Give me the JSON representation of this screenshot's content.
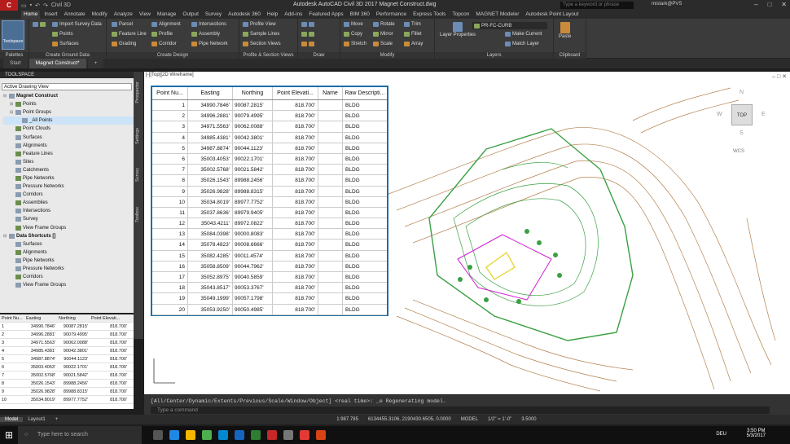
{
  "app": {
    "title": "Autodesk AutoCAD Civil 3D 2017    Magnet Construct.dwg",
    "workspace": "Civil 3D",
    "search_placeholder": "Type a keyword or phrase",
    "user": "mistark@PVS"
  },
  "ribbon_tabs": [
    "Home",
    "Insert",
    "Annotate",
    "Modify",
    "Analyze",
    "View",
    "Manage",
    "Output",
    "Survey",
    "Autodesk 360",
    "Help",
    "Add-ins",
    "Featured Apps",
    "BIM 360",
    "Performance",
    "Express Tools",
    "Topcon",
    "MAGNET Modeler",
    "Autodesk Point Layout"
  ],
  "ribbon": {
    "toolspace": "Toolspace",
    "palettes": "Palettes",
    "create_ground": {
      "label": "Create Ground Data",
      "items": [
        "Import Survey Data",
        "Points",
        "Surfaces"
      ]
    },
    "create_design": {
      "label": "Create Design",
      "items": [
        "Parcel",
        "Feature Line",
        "Grading",
        "Alignment",
        "Profile",
        "Corridor",
        "Intersections",
        "Assembly",
        "Pipe Network"
      ]
    },
    "profile_section": {
      "label": "Profile & Section Views",
      "items": [
        "Profile View",
        "Sample Lines",
        "Section Views"
      ]
    },
    "draw": {
      "label": "Draw"
    },
    "modify": {
      "label": "Modify",
      "items": [
        "Move",
        "Rotate",
        "Trim",
        "Copy",
        "Mirror",
        "Fillet",
        "Stretch",
        "Scale",
        "Array"
      ]
    },
    "layers": {
      "label": "Layers",
      "layer_name": "PR-FC-CURB",
      "items": [
        "Layer Properties",
        "Make Current",
        "Match Layer"
      ]
    },
    "clipboard": {
      "label": "Clipboard",
      "paste": "Paste"
    }
  },
  "file_tabs": [
    "Start",
    "Magnet Construct*"
  ],
  "toolspace": {
    "title": "TOOLSPACE",
    "view": "Active Drawing View",
    "tree": [
      "Magnet Construct",
      "Points",
      "Point Groups",
      "_All Points",
      "Point Clouds",
      "Surfaces",
      "Alignments",
      "Feature Lines",
      "Sites",
      "Catchments",
      "Pipe Networks",
      "Pressure Networks",
      "Corridors",
      "Assemblies",
      "Intersections",
      "Survey",
      "View Frame Groups",
      "Data Shortcuts []",
      "Surfaces",
      "Alignments",
      "Pipe Networks",
      "Pressure Networks",
      "Corridors",
      "View Frame Groups"
    ],
    "side_tabs": [
      "Prospector",
      "Settings",
      "Survey",
      "Toolbox"
    ]
  },
  "viewport": {
    "label": "[-][Top][2D Wireframe]",
    "cube": "TOP",
    "wcs": "WCS",
    "north": "N",
    "south": "S",
    "east": "E",
    "west": "W"
  },
  "point_table": {
    "headers": [
      "Point Nu...",
      "Easting",
      "Northing",
      "Point Elevati...",
      "Name",
      "Raw Descripti..."
    ],
    "rows": [
      [
        "1",
        "34990.7846'",
        "90087.2815'",
        "818.700'",
        "",
        "BLDG"
      ],
      [
        "2",
        "34996.2881'",
        "90079.4995'",
        "818.700'",
        "",
        "BLDG"
      ],
      [
        "3",
        "34971.5563'",
        "90062.0088'",
        "818.700'",
        "",
        "BLDG"
      ],
      [
        "4",
        "34985.4381'",
        "90042.3801'",
        "818.700'",
        "",
        "BLDG"
      ],
      [
        "5",
        "34987.8874'",
        "90044.1123'",
        "818.700'",
        "",
        "BLDG"
      ],
      [
        "6",
        "35003.4053'",
        "90022.1701'",
        "818.700'",
        "",
        "BLDG"
      ],
      [
        "7",
        "35002.5768'",
        "90021.5842'",
        "818.700'",
        "",
        "BLDG"
      ],
      [
        "8",
        "35026.1543'",
        "89988.2456'",
        "818.700'",
        "",
        "BLDG"
      ],
      [
        "9",
        "35026.9828'",
        "89988.8315'",
        "818.700'",
        "",
        "BLDG"
      ],
      [
        "10",
        "35034.8019'",
        "89977.7752'",
        "818.700'",
        "",
        "BLDG"
      ],
      [
        "11",
        "35037.8636'",
        "89979.9405'",
        "818.700'",
        "",
        "BLDG"
      ],
      [
        "12",
        "35043.4211'",
        "89972.0822'",
        "818.700'",
        "",
        "BLDG"
      ],
      [
        "13",
        "35084.0398'",
        "90000.8083'",
        "818.700'",
        "",
        "BLDG"
      ],
      [
        "14",
        "35078.4823'",
        "90008.6666'",
        "818.700'",
        "",
        "BLDG"
      ],
      [
        "15",
        "35082.4285'",
        "90011.4574'",
        "818.700'",
        "",
        "BLDG"
      ],
      [
        "16",
        "35058.8509'",
        "90044.7962'",
        "818.700'",
        "",
        "BLDG"
      ],
      [
        "17",
        "35052.8975'",
        "90040.5859'",
        "818.700'",
        "",
        "BLDG"
      ],
      [
        "18",
        "35043.8517'",
        "90053.3767'",
        "818.700'",
        "",
        "BLDG"
      ],
      [
        "19",
        "35049.1999'",
        "90057.1798'",
        "818.700'",
        "",
        "BLDG"
      ],
      [
        "20",
        "35053.9250'",
        "90050.4985'",
        "818.700'",
        "",
        "BLDG"
      ]
    ]
  },
  "bottom_grid": {
    "headers": [
      "Point Nu...",
      "Easting",
      "Northing",
      "Point Elevati..."
    ],
    "rows": [
      [
        "1",
        "34990.7846'",
        "90087.2815'",
        "818.700'"
      ],
      [
        "2",
        "34996.2881'",
        "90079.4995'",
        "818.700'"
      ],
      [
        "3",
        "34971.5563'",
        "90062.0088'",
        "818.700'"
      ],
      [
        "4",
        "34985.4381'",
        "90042.3801'",
        "818.700'"
      ],
      [
        "5",
        "34987.8874'",
        "90044.1123'",
        "818.700'"
      ],
      [
        "6",
        "35003.4053'",
        "90022.1701'",
        "818.700'"
      ],
      [
        "7",
        "35002.5768'",
        "90021.5842'",
        "818.700'"
      ],
      [
        "8",
        "35026.1543'",
        "89988.2456'",
        "818.700'"
      ],
      [
        "9",
        "35026.9828'",
        "89988.8315'",
        "818.700'"
      ],
      [
        "10",
        "35034.8019'",
        "89977.7752'",
        "818.700'"
      ]
    ]
  },
  "command": {
    "history": "[All/Center/Dynamic/Extents/Previous/Scale/Window/Object] <real time>: _e Regenerating model.",
    "prompt": "Type a command"
  },
  "status": {
    "model": "Model",
    "layout": "Layout1",
    "scale": "1:987.785",
    "coords": "6134455.3106, 2190430.6505, 0.0000",
    "mode": "MODEL",
    "annoscale": "1/2\" = 1'-0\"",
    "value": "3.5000"
  },
  "taskbar": {
    "search": "Type here to search",
    "time": "3:50 PM",
    "date": "5/3/2017",
    "lang": "DEU"
  },
  "colors": {
    "accent": "#1c6fa8",
    "contour_brown": "#b5824f",
    "contour_green": "#3aa043",
    "boundary_magenta": "#d21fd2",
    "building_yellow": "#e3d21d"
  }
}
